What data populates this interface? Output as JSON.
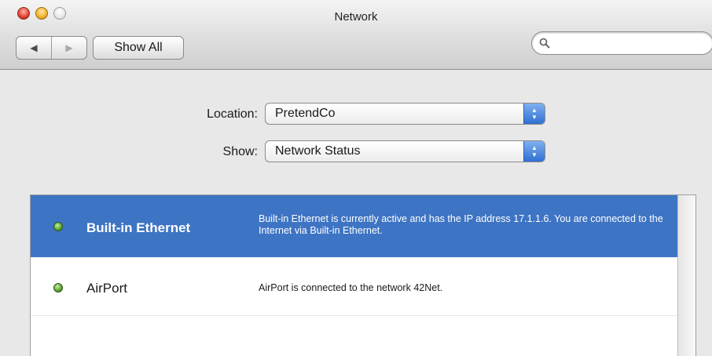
{
  "window": {
    "title": "Network"
  },
  "toolbar": {
    "back_icon": "◀",
    "forward_icon": "▶",
    "show_all_label": "Show All",
    "search_placeholder": "",
    "search_value": ""
  },
  "location": {
    "label": "Location:",
    "value": "PretendCo"
  },
  "show": {
    "label": "Show:",
    "value": "Network Status"
  },
  "services": [
    {
      "name": "Built-in Ethernet",
      "status": "active",
      "selected": true,
      "description": "Built-in Ethernet is currently active and has the IP address 17.1.1.6. You are connected to the Internet via Built-in Ethernet."
    },
    {
      "name": "AirPort",
      "status": "connected",
      "selected": false,
      "description": "AirPort is connected to the network 42Net."
    }
  ],
  "colors": {
    "selection": "#3e74c4",
    "status_green": "#5aa330"
  },
  "icons": {
    "close": "close-icon",
    "minimize": "minimize-icon",
    "zoom": "zoom-icon",
    "search": "search-icon",
    "popup_arrows": "popup-arrows-icon",
    "status": "status-light-icon"
  }
}
